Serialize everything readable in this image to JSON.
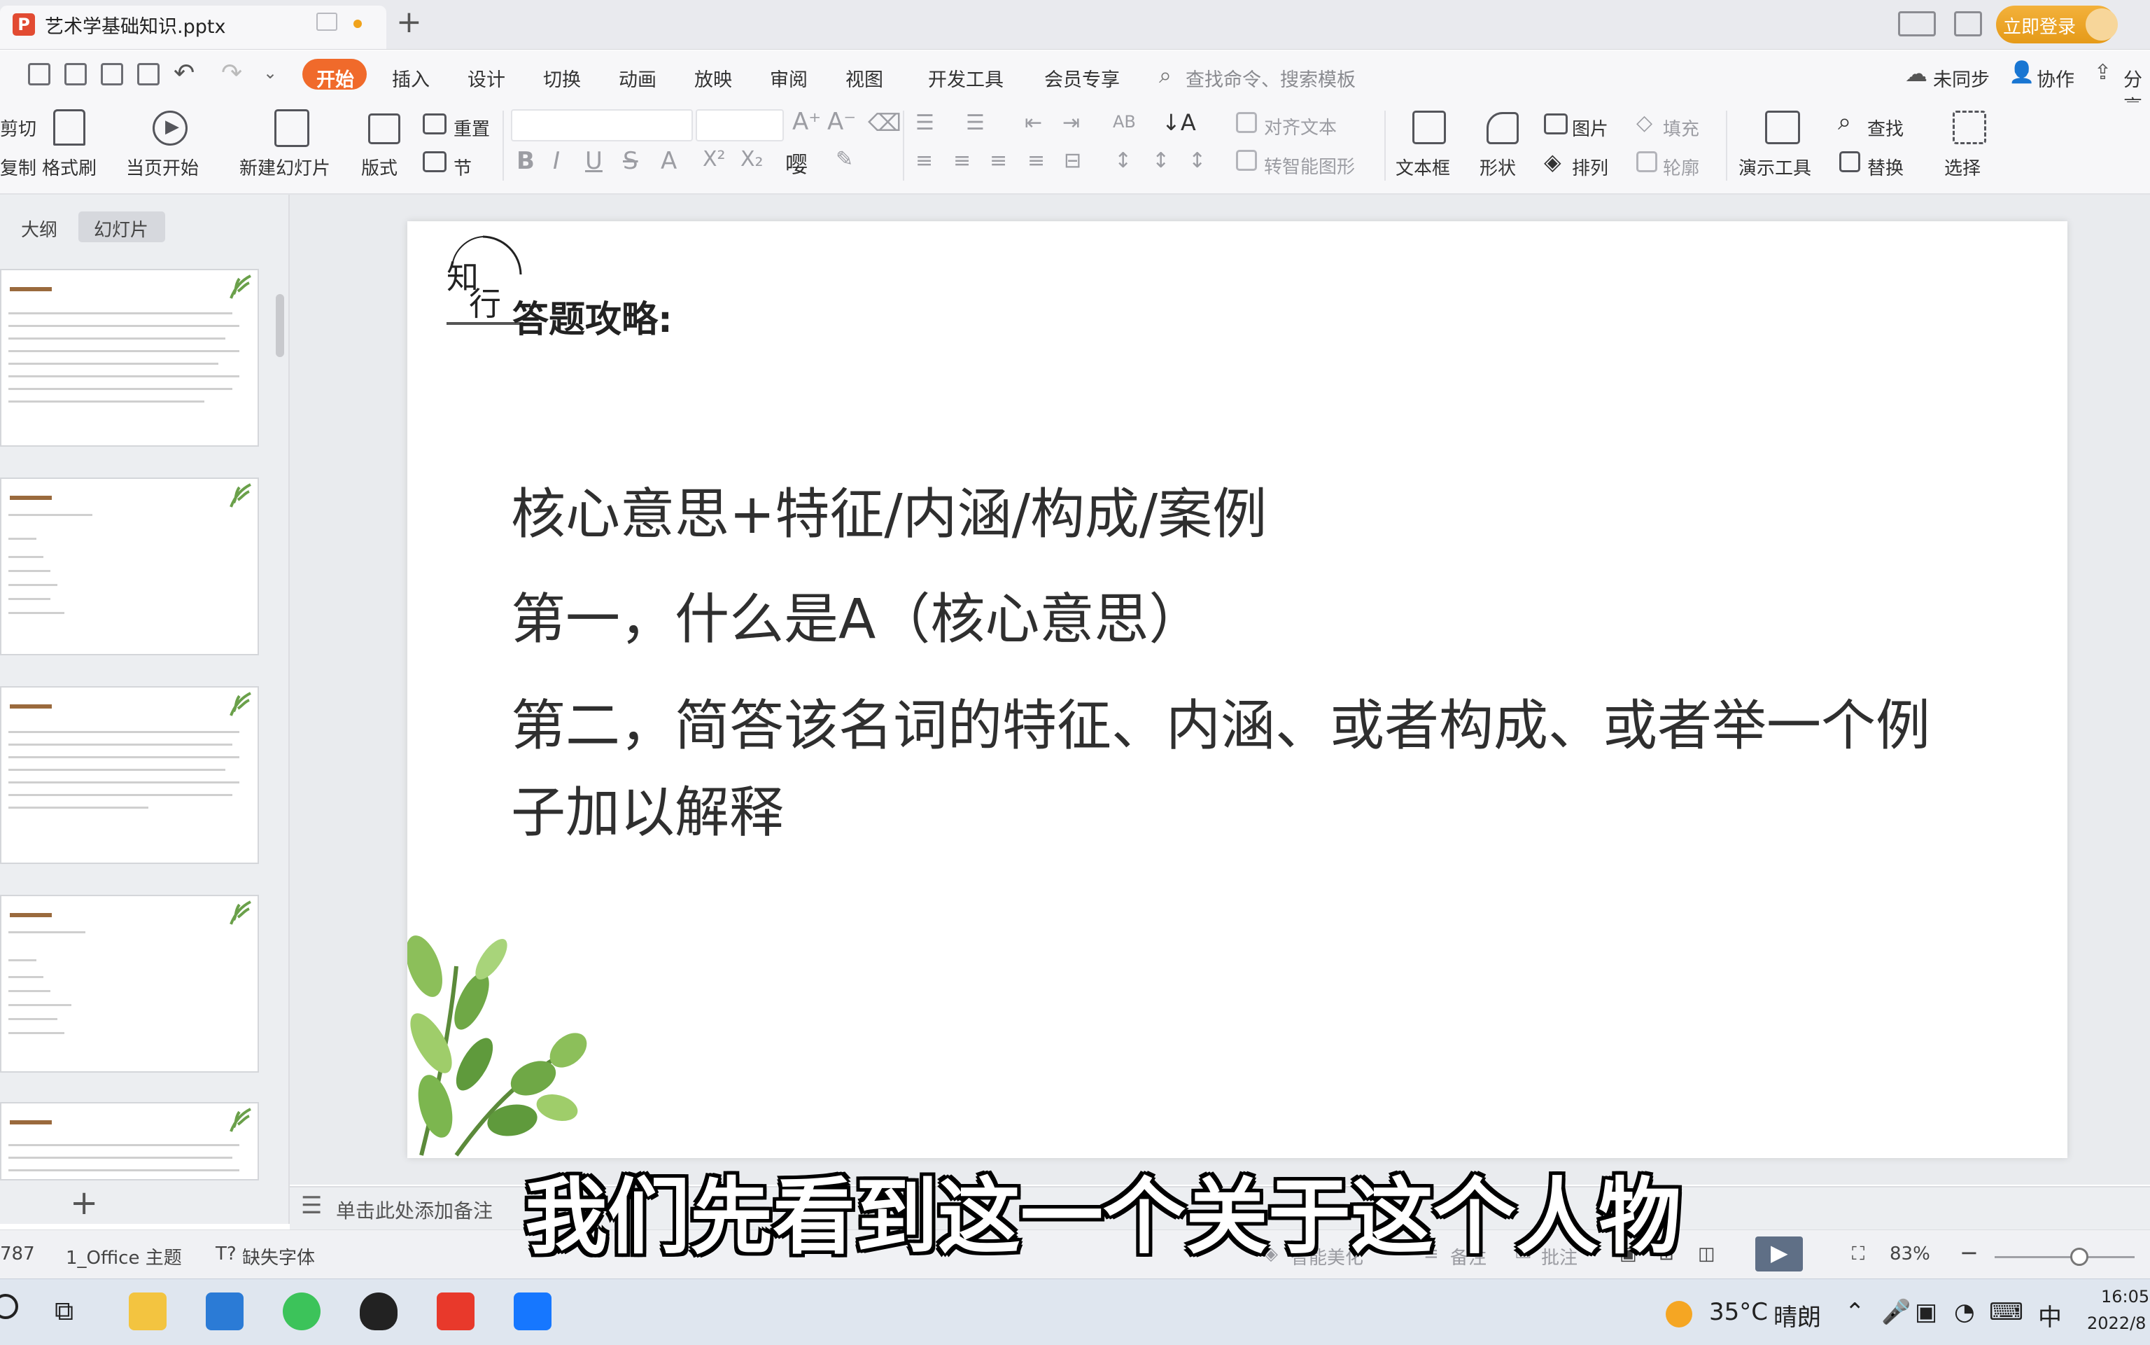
{
  "titlebar": {
    "doc_name": "艺术学基础知识.pptx",
    "login_label": "立即登录"
  },
  "menu": {
    "items": [
      "开始",
      "插入",
      "设计",
      "切换",
      "动画",
      "放映",
      "审阅",
      "视图",
      "开发工具",
      "会员专享"
    ],
    "search_placeholder": "查找命令、搜索模板",
    "sync_label": "未同步",
    "collab_label": "协作",
    "share_label": "分享"
  },
  "ribbon": {
    "cut": "剪切",
    "copy": "复制",
    "format_painter": "格式刷",
    "play_from_current": "当页开始",
    "new_slide": "新建幻灯片",
    "layout": "版式",
    "reset": "重置",
    "section": "节",
    "align_text": "对齐文本",
    "smart_shape": "转智能图形",
    "textbox": "文本框",
    "shape": "形状",
    "picture": "图片",
    "fill": "填充",
    "arrange": "排列",
    "outline": "轮廓",
    "presentation_tools": "演示工具",
    "find": "查找",
    "replace": "替换",
    "select": "选择"
  },
  "left_panel": {
    "tab_outline": "大纲",
    "tab_slides": "幻灯片"
  },
  "slide": {
    "logo_text": "知行",
    "heading": "答题攻略:",
    "lines": [
      "核心意思+特征/内涵/构成/案例",
      "第一，什么是A（核心意思）",
      "第二，简答该名词的特征、内涵、或者构成、或者举一个例",
      "子加以解释"
    ]
  },
  "notes": {
    "placeholder": "单击此处添加备注"
  },
  "status": {
    "slide_no": "787",
    "theme": "1_Office 主题",
    "missing_font": "缺失字体",
    "beautify": "智能美化",
    "notes": "备注",
    "comments": "批注",
    "zoom": "83%"
  },
  "subtitle": "我们先看到这一个关于这个人物",
  "taskbar": {
    "temperature": "35°C",
    "weather": "晴朗",
    "ime": "中",
    "time": "16:05",
    "date": "2022/8"
  }
}
